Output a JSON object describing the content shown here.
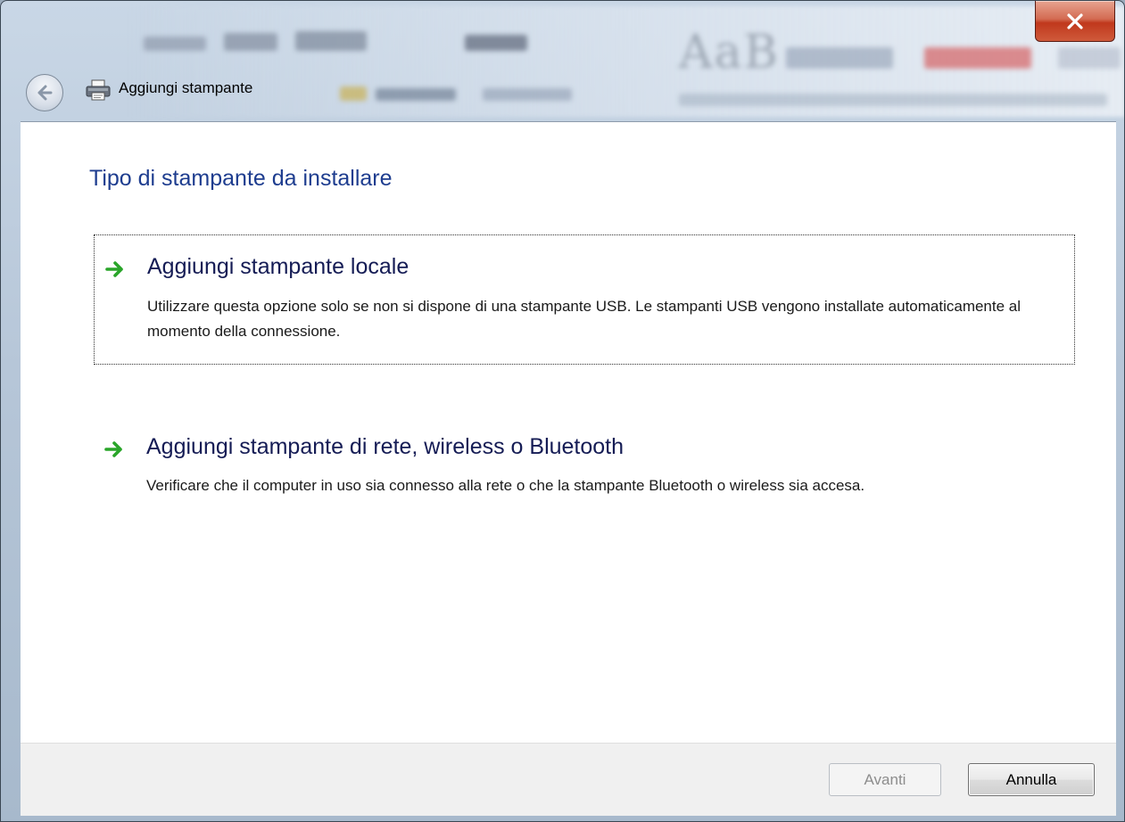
{
  "window": {
    "title": "Aggiungi stampante"
  },
  "content": {
    "heading": "Tipo di stampante da installare",
    "options": [
      {
        "title": "Aggiungi stampante locale",
        "description": "Utilizzare questa opzione solo se non si dispone di una stampante USB. Le stampanti USB vengono installate automaticamente al momento della connessione."
      },
      {
        "title": "Aggiungi stampante di rete, wireless o Bluetooth",
        "description": "Verificare che il computer in uso sia connesso alla rete o che la stampante Bluetooth o wireless sia accesa."
      }
    ]
  },
  "footer": {
    "next_label": "Avanti",
    "cancel_label": "Annulla"
  },
  "background_text": "AaB",
  "icons": {
    "close": "close-icon",
    "back": "back-arrow-icon",
    "printer": "printer-icon",
    "option_arrow": "green-arrow-icon"
  },
  "colors": {
    "heading": "#1e3d8f",
    "option_title": "#151c55",
    "close_button": "#c0381c",
    "arrow": "#2aa52a"
  }
}
